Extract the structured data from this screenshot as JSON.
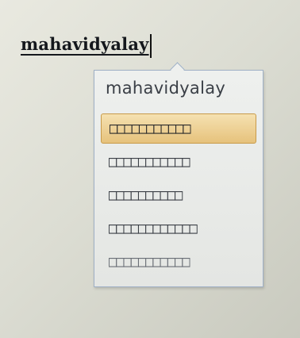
{
  "editor": {
    "typed_text": "mahavidyalay"
  },
  "ime_popup": {
    "header": "mahavidyalay",
    "suggestions": [
      {
        "label": "□□□□□□□□□□□",
        "selected": true
      },
      {
        "label": "□□□□□□□□□□□",
        "selected": false
      },
      {
        "label": "□□□□□□□□□□",
        "selected": false
      },
      {
        "label": "□□□□□□□□□□□□",
        "selected": false
      },
      {
        "label": "□□□□□□□□□□□",
        "selected": false
      }
    ]
  }
}
